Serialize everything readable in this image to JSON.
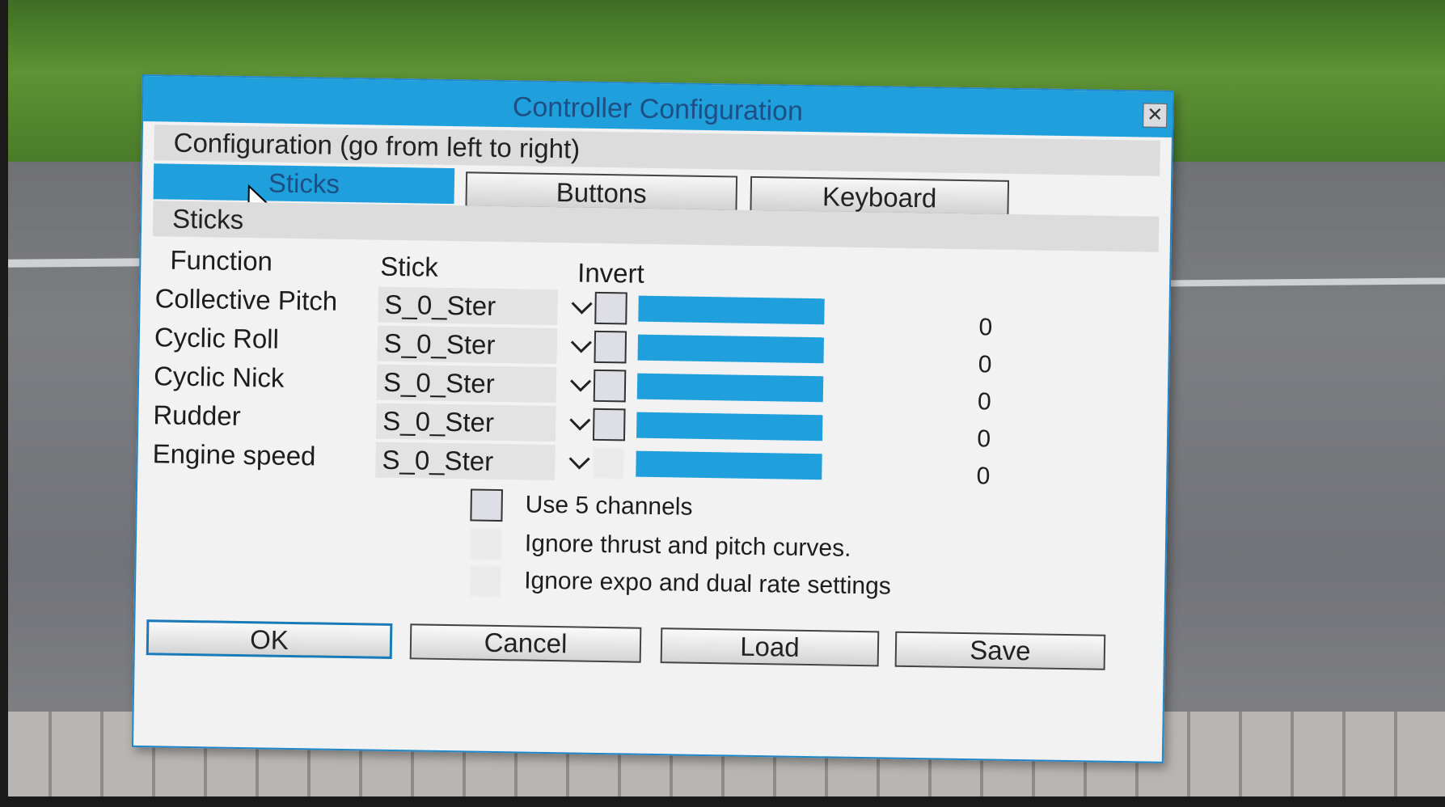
{
  "dialog": {
    "title": "Controller Configuration",
    "subtitle": "Configuration (go from left to right)",
    "close_glyph": "✕"
  },
  "tabs": [
    {
      "label": "Sticks",
      "active": true
    },
    {
      "label": "Buttons",
      "active": false
    },
    {
      "label": "Keyboard",
      "active": false
    }
  ],
  "sticks_section": {
    "title": "Sticks",
    "columns": {
      "function": "Function",
      "stick": "Stick",
      "invert": "Invert"
    },
    "rows": [
      {
        "function": "Collective Pitch",
        "stick": "S_0_Ster",
        "invert_enabled": true,
        "inverted": false,
        "level": 1.0,
        "value": "0"
      },
      {
        "function": "Cyclic Roll",
        "stick": "S_0_Ster",
        "invert_enabled": true,
        "inverted": false,
        "level": 1.0,
        "value": "0"
      },
      {
        "function": "Cyclic Nick",
        "stick": "S_0_Ster",
        "invert_enabled": true,
        "inverted": false,
        "level": 1.0,
        "value": "0"
      },
      {
        "function": "Rudder",
        "stick": "S_0_Ster",
        "invert_enabled": true,
        "inverted": false,
        "level": 1.0,
        "value": "0"
      },
      {
        "function": "Engine speed",
        "stick": "S_0_Ster",
        "invert_enabled": false,
        "inverted": false,
        "level": 1.0,
        "value": "0"
      }
    ]
  },
  "options": [
    {
      "label": "Use 5 channels",
      "enabled": true,
      "checked": false
    },
    {
      "label": "Ignore thrust and pitch curves.",
      "enabled": false,
      "checked": false
    },
    {
      "label": "Ignore expo and dual rate settings",
      "enabled": false,
      "checked": false
    }
  ],
  "footer_buttons": [
    {
      "label": "OK",
      "default": true
    },
    {
      "label": "Cancel",
      "default": false
    },
    {
      "label": "Load",
      "default": false
    },
    {
      "label": "Save",
      "default": false
    }
  ],
  "colors": {
    "accent": "#1fa0dc",
    "title_text": "#1d4f84",
    "dialog_bg": "#f2f2f2"
  },
  "icons": {
    "dropdown": "chevron-down-icon",
    "close": "close-icon",
    "cursor": "mouse-pointer-icon"
  }
}
